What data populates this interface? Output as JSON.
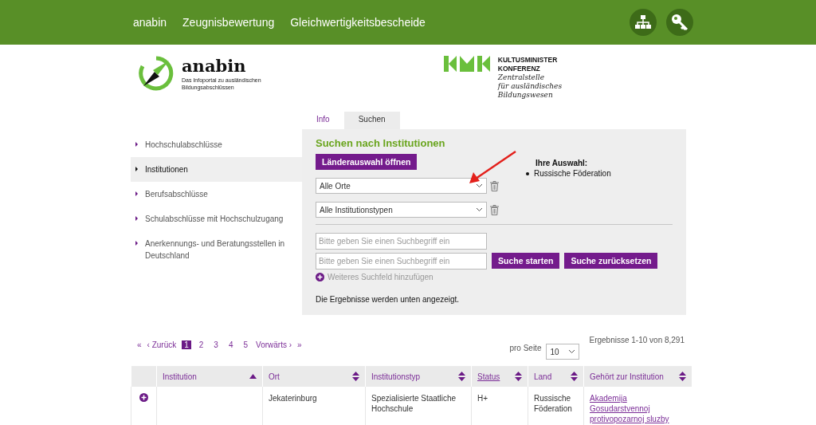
{
  "topnav": {
    "items": [
      "anabin",
      "Zeugnisbewertung",
      "Gleichwertigkeitsbescheide"
    ]
  },
  "header": {
    "logo": {
      "name": "anabin",
      "tagline_1": "Das Infoportal zu ausländischen",
      "tagline_2": "Bildungsabschlüssen"
    },
    "partner": {
      "line_1": "KULTUSMINISTER",
      "line_2": "KONFERENZ",
      "line_3": "Zentralstelle",
      "line_4": "für ausländisches",
      "line_5": "Bildungswesen"
    }
  },
  "sidebar": {
    "items": [
      {
        "label": "Hochschulabschlüsse",
        "selected": false
      },
      {
        "label": "Institutionen",
        "selected": true
      },
      {
        "label": "Berufsabschlüsse",
        "selected": false
      },
      {
        "label": "Schulabschlüsse mit Hochschulzugang",
        "selected": false
      },
      {
        "label": "Anerkennungs- und Beratungsstellen in Deutschland",
        "selected": false
      }
    ]
  },
  "tabs": [
    {
      "label": "Info",
      "selected": false
    },
    {
      "label": "Suchen",
      "selected": true
    }
  ],
  "search": {
    "title": "Suchen nach Institutionen",
    "country_button": "Länderauswahl öffnen",
    "selection_title": "Ihre Auswahl:",
    "selection": [
      "Russische Föderation"
    ],
    "dropdowns": [
      "Alle Orte",
      "Alle Institutionstypen"
    ],
    "fields": [
      {
        "placeholder": "Bitte geben Sie einen Suchbegriff ein"
      },
      {
        "placeholder": "Bitte geben Sie einen Suchbegriff ein"
      }
    ],
    "start_button": "Suche starten",
    "reset_button": "Suche zurücksetzen",
    "add_field": "Weiteres Suchfeld hinzufügen",
    "note": "Die Ergebnisse werden unten angezeigt."
  },
  "pagination": {
    "first": "«",
    "prev": "‹ Zurück",
    "pages": [
      {
        "label": "1",
        "selected": true
      },
      {
        "label": "2",
        "selected": false
      },
      {
        "label": "3",
        "selected": false
      },
      {
        "label": "4",
        "selected": false
      },
      {
        "label": "5",
        "selected": false
      }
    ],
    "next": "Vorwärts ›",
    "last": "»",
    "per_page_label": "pro Seite",
    "per_page": "10",
    "results": "Ergebnisse 1-10 von 8,291"
  },
  "table": {
    "columns": [
      {
        "label": "Institution",
        "sorted": true,
        "link": false
      },
      {
        "label": "Ort",
        "sorted": false,
        "link": false
      },
      {
        "label": "Institutionstyp",
        "sorted": false,
        "link": false
      },
      {
        "label": "Status",
        "sorted": false,
        "link": true
      },
      {
        "label": "Land",
        "sorted": false,
        "link": false
      },
      {
        "label": "Gehört zur Institution",
        "sorted": false,
        "link": false
      }
    ],
    "rows": [
      {
        "cells": [
          "",
          "Jekaterinburg",
          "Spezialisierte Staatliche Hochschule",
          "H+",
          "Russische Föderation"
        ],
        "parent": "Akademija Gosudarstvennoj protivopozarnoj sluzby"
      }
    ]
  }
}
